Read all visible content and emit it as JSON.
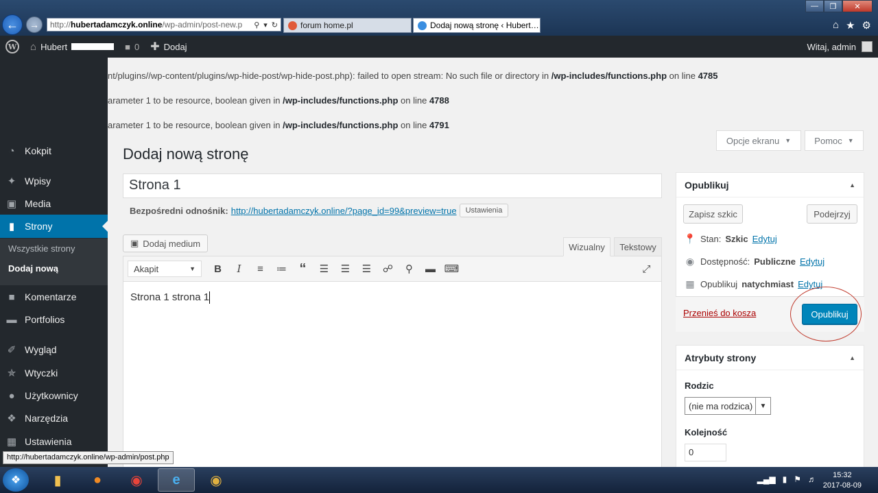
{
  "browser": {
    "url_prefix": "http://",
    "url_host": "hubertadamczyk.online",
    "url_path": "/wp-admin/post-new.p",
    "tabs": [
      {
        "title": "forum home.pl",
        "fav_color": "#e05a3a"
      },
      {
        "title": "Dodaj nową stronę ‹ Hubert…",
        "fav_color": "#3a8ee0"
      }
    ],
    "back_icon": "arrow-left-icon",
    "forward_icon": "arrow-right-icon"
  },
  "adminbar": {
    "site_name": "Hubert",
    "comments_count": "0",
    "new_label": "Dodaj",
    "howdy": "Witaj, admin"
  },
  "sidebar": {
    "items": [
      {
        "label": "Kokpit",
        "icon": "dashboard-icon"
      },
      {
        "label": "Wpisy",
        "icon": "pin-icon"
      },
      {
        "label": "Media",
        "icon": "media-icon"
      },
      {
        "label": "Strony",
        "icon": "pages-icon"
      },
      {
        "label": "Komentarze",
        "icon": "comment-icon"
      },
      {
        "label": "Portfolios",
        "icon": "folder-icon"
      },
      {
        "label": "Wygląd",
        "icon": "brush-icon"
      },
      {
        "label": "Wtyczki",
        "icon": "plugin-icon"
      },
      {
        "label": "Użytkownicy",
        "icon": "users-icon"
      },
      {
        "label": "Narzędzia",
        "icon": "wrench-icon"
      },
      {
        "label": "Ustawienia",
        "icon": "settings-icon"
      }
    ],
    "submenu": [
      "Wszystkie strony",
      "Dodaj nową"
    ]
  },
  "notices": [
    {
      "text": "nt/plugins//wp-content/plugins/wp-hide-post/wp-hide-post.php): failed to open stream: No such file or directory in ",
      "file": "/wp-includes/functions.php",
      "mid": " on line ",
      "line": "4785"
    },
    {
      "text": "arameter 1 to be resource, boolean given in ",
      "file": "/wp-includes/functions.php",
      "mid": " on line ",
      "line": "4788"
    },
    {
      "text": "arameter 1 to be resource, boolean given in ",
      "file": "/wp-includes/functions.php",
      "mid": " on line ",
      "line": "4791"
    }
  ],
  "screen_options": "Opcje ekranu",
  "help": "Pomoc",
  "page_title": "Dodaj nową stronę",
  "post_title": "Strona 1",
  "permalink": {
    "label": "Bezpośredni odnośnik:",
    "url": "http://hubertadamczyk.online/?page_id=99&preview=true",
    "settings": "Ustawienia"
  },
  "editor": {
    "add_media": "Dodaj medium",
    "tab_visual": "Wizualny",
    "tab_text": "Tekstowy",
    "format": "Akapit",
    "content": "Strona 1 strona 1"
  },
  "publish_box": {
    "title": "Opublikuj",
    "save_draft": "Zapisz szkic",
    "preview": "Podejrzyj",
    "status_label": "Stan:",
    "status_value": "Szkic",
    "visibility_label": "Dostępność:",
    "visibility_value": "Publiczne",
    "publish_label": "Opublikuj",
    "publish_value": "natychmiast",
    "edit": "Edytuj",
    "trash": "Przenieś do kosza",
    "publish_button": "Opublikuj"
  },
  "attributes_box": {
    "title": "Atrybuty strony",
    "parent_label": "Rodzic",
    "parent_value": "(nie ma rodzica)",
    "order_label": "Kolejność",
    "order_value": "0"
  },
  "status_url": "http://hubertadamczyk.online/wp-admin/post.php",
  "taskbar": {
    "time": "15:32",
    "date": "2017-08-09"
  },
  "colors": {
    "accent": "#0073aa",
    "publish": "#0085ba",
    "admin_dark": "#23282d",
    "trash": "#aa0000"
  }
}
